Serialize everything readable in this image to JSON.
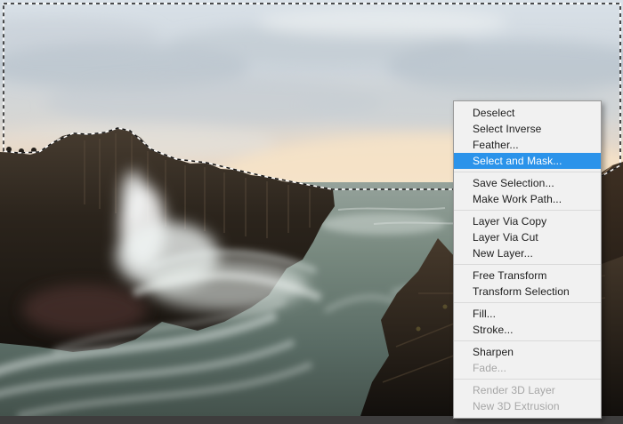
{
  "window": {
    "pasteboard_color": "#3e3d3d"
  },
  "canvas": {
    "description": "Long-exposure seascape photograph: dark basalt sea cliffs on the left, silky white waves crashing below, calm teal sea to the right, soft sunset sky; an active marching-ants selection outlines the sky region above the cliffs and horizon",
    "selection_active": true,
    "palette": {
      "sky_top": "#d9e1e8",
      "sky_horizon_warm": "#f1e1cc",
      "sea": "#5f706b",
      "cliff_dark": "#1b150f",
      "foam_white": "#eef3f1"
    }
  },
  "context_menu": {
    "highlighted_item": "Select and Mask...",
    "colors": {
      "background": "#f1f1f1",
      "border": "#9a9a9a",
      "highlight": "#2b93ea",
      "text": "#1b1b1b",
      "disabled_text": "#a6a6a6"
    },
    "groups": [
      {
        "items": [
          {
            "label": "Deselect"
          },
          {
            "label": "Select Inverse"
          },
          {
            "label": "Feather..."
          },
          {
            "label": "Select and Mask...",
            "highlighted": true
          }
        ]
      },
      {
        "items": [
          {
            "label": "Save Selection..."
          },
          {
            "label": "Make Work Path..."
          }
        ]
      },
      {
        "items": [
          {
            "label": "Layer Via Copy"
          },
          {
            "label": "Layer Via Cut"
          },
          {
            "label": "New Layer..."
          }
        ]
      },
      {
        "items": [
          {
            "label": "Free Transform"
          },
          {
            "label": "Transform Selection"
          }
        ]
      },
      {
        "items": [
          {
            "label": "Fill..."
          },
          {
            "label": "Stroke..."
          }
        ]
      },
      {
        "items": [
          {
            "label": "Sharpen"
          },
          {
            "label": "Fade...",
            "disabled": true
          }
        ]
      },
      {
        "items": [
          {
            "label": "Render 3D Layer",
            "disabled": true
          },
          {
            "label": "New 3D Extrusion",
            "disabled": true
          }
        ]
      }
    ]
  }
}
